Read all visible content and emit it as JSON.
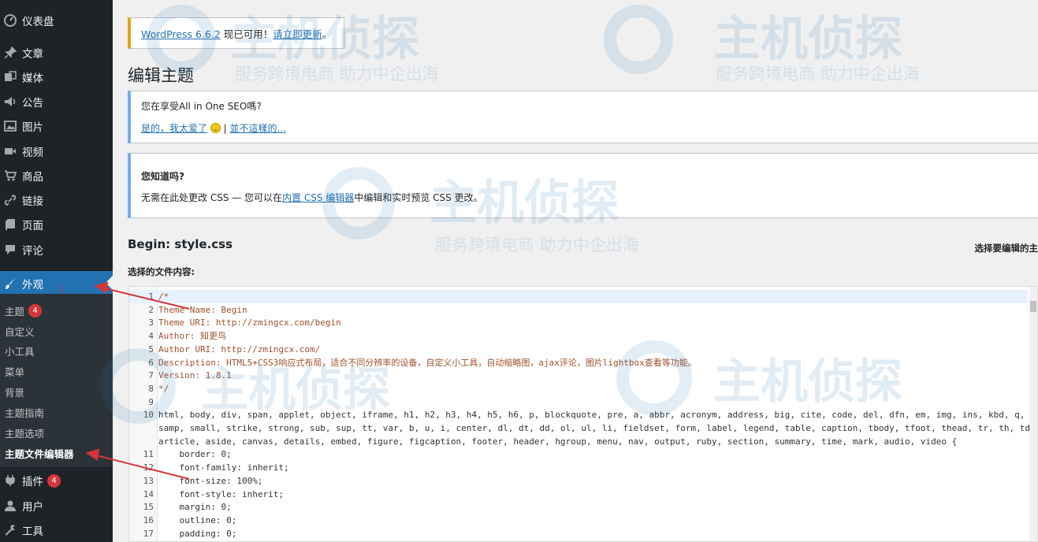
{
  "sidebar": {
    "items": [
      {
        "label": "仪表盘",
        "icon": "dashboard-icon"
      },
      {
        "label": "文章",
        "icon": "pin-icon"
      },
      {
        "label": "媒体",
        "icon": "media-icon"
      },
      {
        "label": "公告",
        "icon": "megaphone-icon"
      },
      {
        "label": "图片",
        "icon": "image-icon"
      },
      {
        "label": "视频",
        "icon": "video-icon"
      },
      {
        "label": "商品",
        "icon": "cart-icon"
      },
      {
        "label": "链接",
        "icon": "link-icon"
      },
      {
        "label": "页面",
        "icon": "page-icon"
      },
      {
        "label": "评论",
        "icon": "comment-icon"
      },
      {
        "label": "外观",
        "icon": "brush-icon"
      }
    ],
    "submenu": [
      {
        "label": "主题",
        "badge": "4"
      },
      {
        "label": "自定义"
      },
      {
        "label": "小工具"
      },
      {
        "label": "菜单"
      },
      {
        "label": "背景"
      },
      {
        "label": "主题指南"
      },
      {
        "label": "主题选项"
      },
      {
        "label": "主题文件编辑器"
      }
    ],
    "bottom": [
      {
        "label": "插件",
        "icon": "plugin-icon",
        "badge": "4"
      },
      {
        "label": "用户",
        "icon": "user-icon"
      },
      {
        "label": "工具",
        "icon": "wrench-icon"
      }
    ]
  },
  "update_nag": {
    "version_link": "WordPress 6.6.2",
    "text": " 现已可用！",
    "update_link": "请立即更新",
    "period": "。"
  },
  "page_title": "编辑主题",
  "notice_seo": {
    "question": "您在享受All in One SEO嗎?",
    "yes_link": "是的，我太爱了",
    "sep": " | ",
    "no_link": "並不這樣的..."
  },
  "notice_css": {
    "heading": "您知道吗?",
    "text_before": "无需在此处更改 CSS — 您可以在",
    "link": "内置 CSS 编辑器",
    "text_after": "中编辑和实时预览 CSS 更改。"
  },
  "file_title": "Begin: style.css",
  "select_theme_label": "选择要编辑的主",
  "file_content_label": "选择的文件内容:",
  "code_lines": [
    {
      "n": "1",
      "text": "/*",
      "kind": "comment"
    },
    {
      "n": "2",
      "text": "Theme Name: Begin",
      "kind": "comment"
    },
    {
      "n": "3",
      "text": "Theme URI: http://zmingcx.com/begin",
      "kind": "comment"
    },
    {
      "n": "4",
      "text": "Author: 知更鸟",
      "kind": "comment"
    },
    {
      "n": "5",
      "text": "Author URI: http://zmingcx.com/",
      "kind": "comment"
    },
    {
      "n": "6",
      "text": "Description: HTML5+CSS3响应式布局，适合不同分辨率的设备，自定义小工具，自动缩略图，ajax评论，图片lightbox查看等功能。",
      "kind": "comment"
    },
    {
      "n": "7",
      "text": "Version: 1.8.1",
      "kind": "comment"
    },
    {
      "n": "8",
      "text": "*/",
      "kind": "comment"
    },
    {
      "n": "9",
      "text": "",
      "kind": "code"
    },
    {
      "n": "10",
      "text": "html, body, div, span, applet, object, iframe, h1, h2, h3, h4, h5, h6, p, blockquote, pre, a, abbr, acronym, address, big, cite, code, del, dfn, em, img, ins, kbd, q, s,",
      "kind": "code"
    },
    {
      "n": "",
      "text": "samp, small, strike, strong, sub, sup, tt, var, b, u, i, center, dl, dt, dd, ol, ul, li, fieldset, form, label, legend, table, caption, tbody, tfoot, thead, tr, th, td,",
      "kind": "code"
    },
    {
      "n": "",
      "text": "article, aside, canvas, details, embed, figure, figcaption, footer, header, hgroup, menu, nav, output, ruby, section, summary, time, mark, audio, video {",
      "kind": "code"
    },
    {
      "n": "11",
      "text": "    border: 0;",
      "kind": "code"
    },
    {
      "n": "12",
      "text": "    font-family: inherit;",
      "kind": "code"
    },
    {
      "n": "13",
      "text": "    font-size: 100%;",
      "kind": "code"
    },
    {
      "n": "14",
      "text": "    font-style: inherit;",
      "kind": "code"
    },
    {
      "n": "15",
      "text": "    margin: 0;",
      "kind": "code"
    },
    {
      "n": "16",
      "text": "    outline: 0;",
      "kind": "code"
    },
    {
      "n": "17",
      "text": "    padding: 0;",
      "kind": "code"
    }
  ],
  "watermark": {
    "brand": "主机侦探",
    "slogan": "服务跨境电商 助力中企出海"
  },
  "colors": {
    "sidebar_bg": "#1d2327",
    "active": "#2271b1",
    "badge": "#d63638",
    "arrow": "#d63638",
    "notice_border": "#72aee6",
    "update_border": "#dba617"
  }
}
